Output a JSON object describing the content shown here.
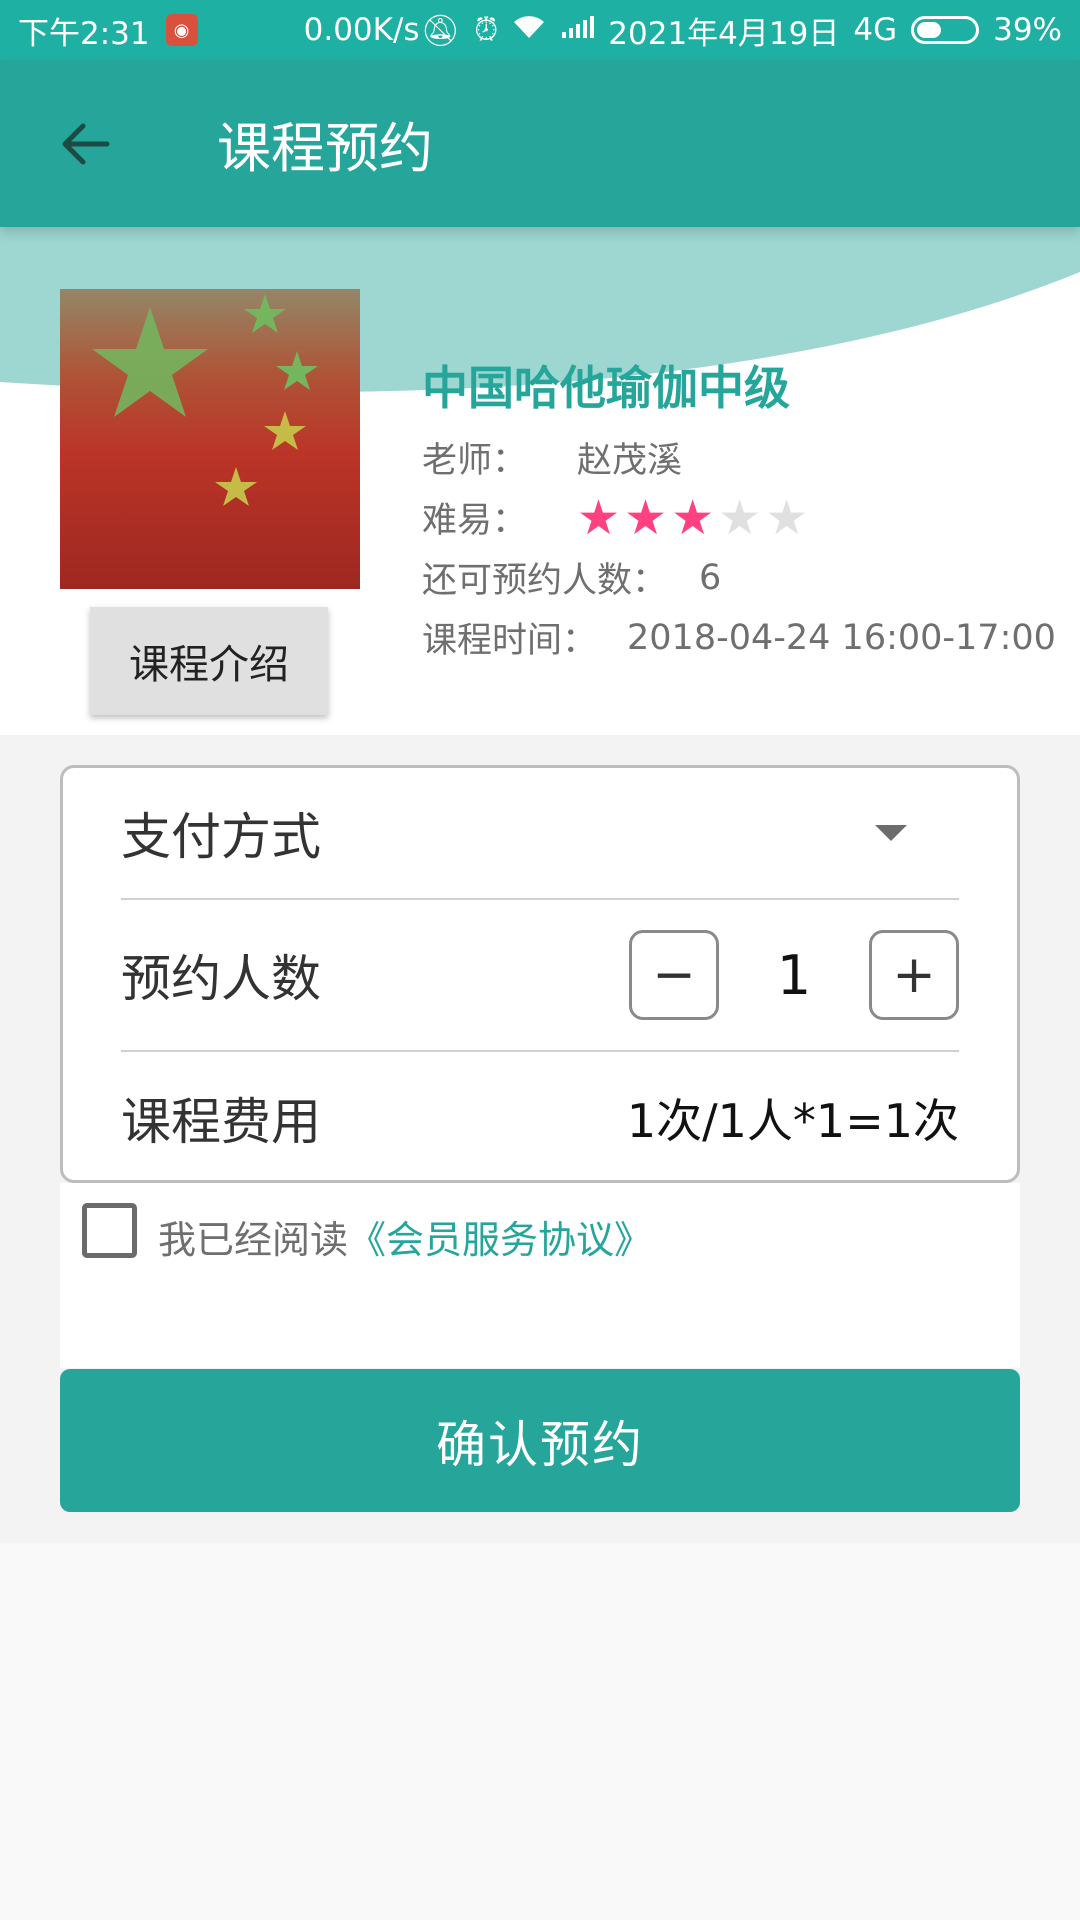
{
  "status_bar": {
    "time": "下午2:31",
    "net_speed": "0.00K/s",
    "date": "2021年4月19日",
    "network": "4G",
    "battery": "39%"
  },
  "app_bar": {
    "title": "课程预约"
  },
  "course": {
    "name": "中国哈他瑜伽中级",
    "teacher_label": "老师：",
    "teacher": "赵茂溪",
    "difficulty_label": "难易：",
    "difficulty_rating": 3,
    "difficulty_max": 5,
    "remaining_label": "还可预约人数：",
    "remaining": "6",
    "time_label": "课程时间：",
    "time": "2018-04-24 16:00-17:00",
    "intro_button": "课程介绍"
  },
  "form": {
    "payment_label": "支付方式",
    "count_label": "预约人数",
    "count_value": "1",
    "minus": "−",
    "plus": "+",
    "fee_label": "课程费用",
    "fee_value": "1次/1人*1=1次"
  },
  "agreement": {
    "text": "我已经阅读",
    "link": "《会员服务协议》"
  },
  "confirm_button": "确认预约",
  "colors": {
    "primary": "#26a69a",
    "status_bar": "#1fb0a4",
    "star_active": "#ff4081",
    "star_inactive": "#e0e0e0"
  }
}
